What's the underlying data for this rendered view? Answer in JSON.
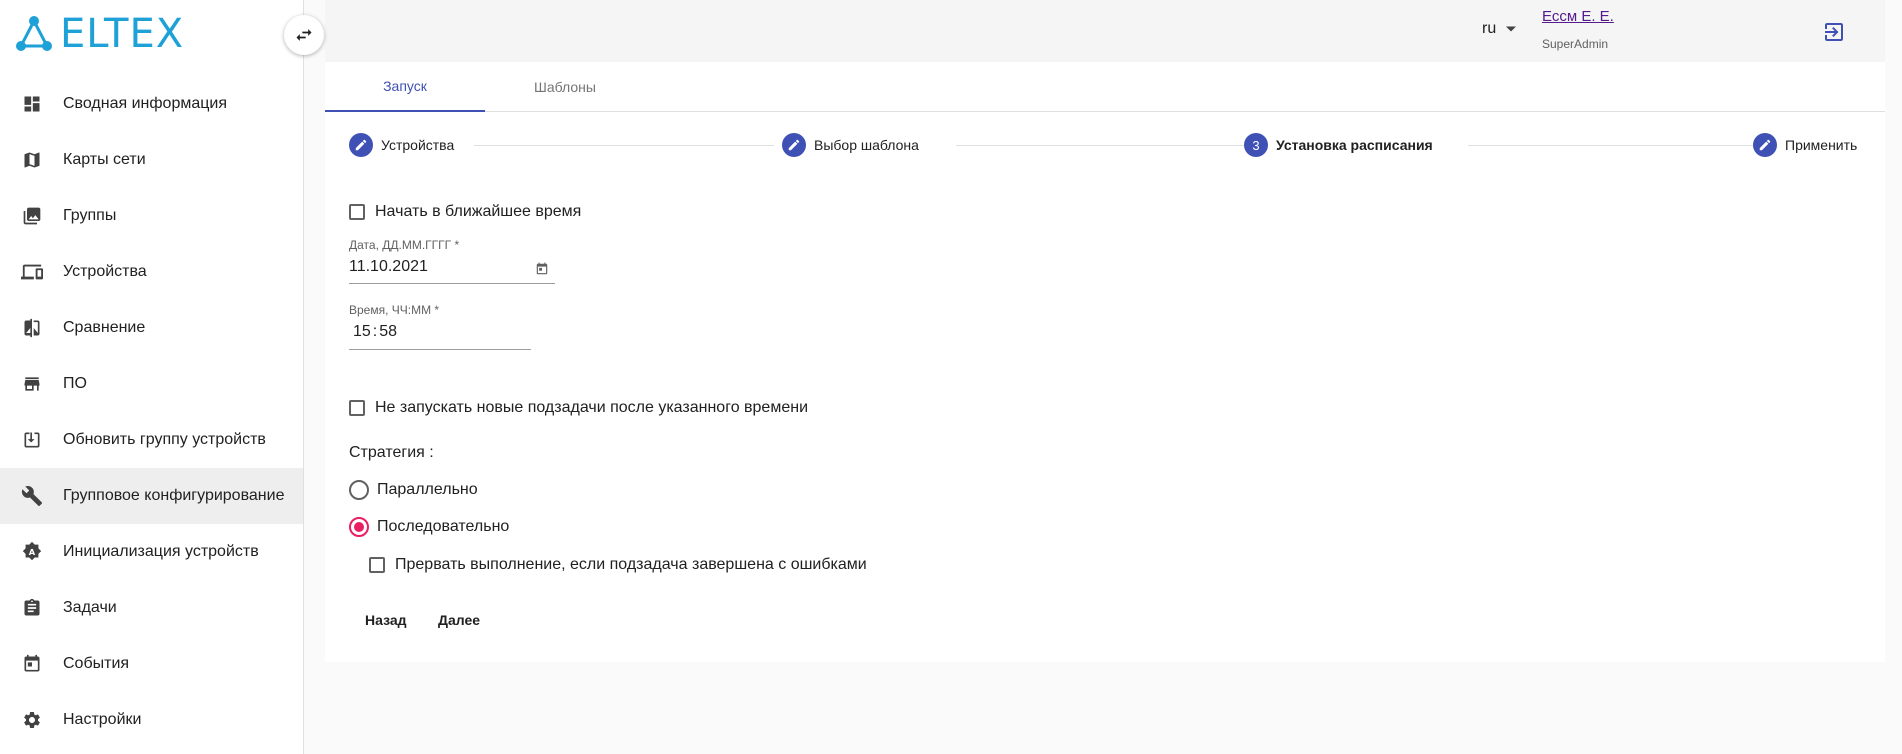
{
  "brand": {
    "name": "ELTEX",
    "accent": "#1ea1d6"
  },
  "sidebar": {
    "items": [
      {
        "label": "Сводная информация",
        "icon": "dashboard-icon"
      },
      {
        "label": "Карты сети",
        "icon": "map-icon"
      },
      {
        "label": "Группы",
        "icon": "photo-library-icon"
      },
      {
        "label": "Устройства",
        "icon": "devices-icon"
      },
      {
        "label": "Сравнение",
        "icon": "compare-icon"
      },
      {
        "label": "ПО",
        "icon": "store-icon"
      },
      {
        "label": "Обновить группу устройств",
        "icon": "download-box-icon"
      },
      {
        "label": "Групповое конфигурирование",
        "icon": "wrench-icon",
        "active": true
      },
      {
        "label": "Инициализация устройств",
        "icon": "auto-badge-icon"
      },
      {
        "label": "Задачи",
        "icon": "assignment-icon"
      },
      {
        "label": "События",
        "icon": "event-icon"
      },
      {
        "label": "Настройки",
        "icon": "gear-icon"
      }
    ]
  },
  "header": {
    "lang": "ru",
    "user_name": "Ессм Е. Е.",
    "user_role": "SuperAdmin"
  },
  "tabs": [
    {
      "label": "Запуск",
      "active": true
    },
    {
      "label": "Шаблоны",
      "active": false
    }
  ],
  "stepper": [
    {
      "label": "Устройства",
      "marker": "edit"
    },
    {
      "label": "Выбор шаблона",
      "marker": "edit"
    },
    {
      "label": "Установка расписания",
      "marker": "3"
    },
    {
      "label": "Применить",
      "marker": "edit"
    }
  ],
  "form": {
    "start_asap": "Начать в ближайшее время",
    "date_label": "Дата, ДД.ММ.ГГГГ *",
    "date_value": "11.10.2021",
    "time_label": "Время, ЧЧ:ММ *",
    "time_hours": "15",
    "time_sep": ":",
    "time_minutes": "58",
    "no_new_subtasks": "Не запускать новые подзадачи после указанного времени",
    "strategy_label": "Стратегия :",
    "strategy_parallel": "Параллельно",
    "strategy_sequential": "Последовательно",
    "abort_on_error": "Прервать выполнение, если подзадача завершена с ошибками",
    "back": "Назад",
    "next": "Далее"
  },
  "colors": {
    "primary": "#3f51b5",
    "radio_accent": "#e91e63"
  }
}
